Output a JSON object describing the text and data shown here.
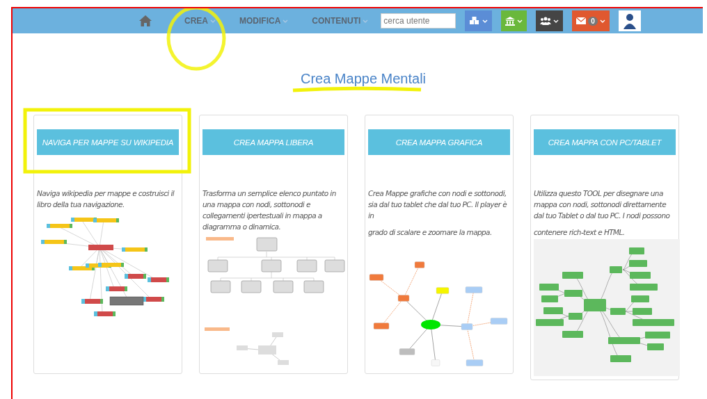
{
  "navbar": {
    "menu": [
      {
        "label": "CREA"
      },
      {
        "label": "MODIFICA"
      },
      {
        "label": "CONTENUTI"
      }
    ],
    "search": {
      "placeholder": "cerca utente"
    },
    "icon_buttons": [
      {
        "kind": "cubes",
        "color": "#5b8dd6"
      },
      {
        "kind": "bank",
        "color": "#6ab83c"
      },
      {
        "kind": "users",
        "color": "#454545"
      },
      {
        "kind": "mail",
        "color": "#e0582f",
        "badge": "0"
      }
    ]
  },
  "page_title": "Crea Mappe Mentali",
  "cards": [
    {
      "button": "NAVIGA PER MAPPE SU WIKIPEDIA",
      "description": [
        "Naviga wikipedia per mappe e costruisci il libro della tua navigazione."
      ],
      "picture": {
        "kind": "network"
      }
    },
    {
      "button": "CREA MAPPA LIBERA",
      "description": [
        "Trasforma un semplice elenco puntato in una mappa con nodi, sottonodi e collegamenti ipertestuali in mappa a diagramma o dinamica."
      ],
      "picture": {
        "kind": "diagram"
      }
    },
    {
      "button": "CREA MAPPA GRAFICA",
      "description": [
        "Crea Mappe grafiche con nodi e sottonodi, sia dal tuo tablet che dal tuo PC. Il player è in",
        "grado di scalare e zoomare la mappa."
      ],
      "picture": {
        "kind": "graph"
      }
    },
    {
      "button": "CREA MAPPA CON PC/TABLET",
      "description": [
        "Utilizza questo TOOL per disegnare una mappa con nodi, sottonodi direttamente dal tuo Tablet o dal tuo PC. I nodi possono",
        "contenere rich-text e HTML."
      ],
      "picture": {
        "kind": "mindmap"
      }
    }
  ]
}
